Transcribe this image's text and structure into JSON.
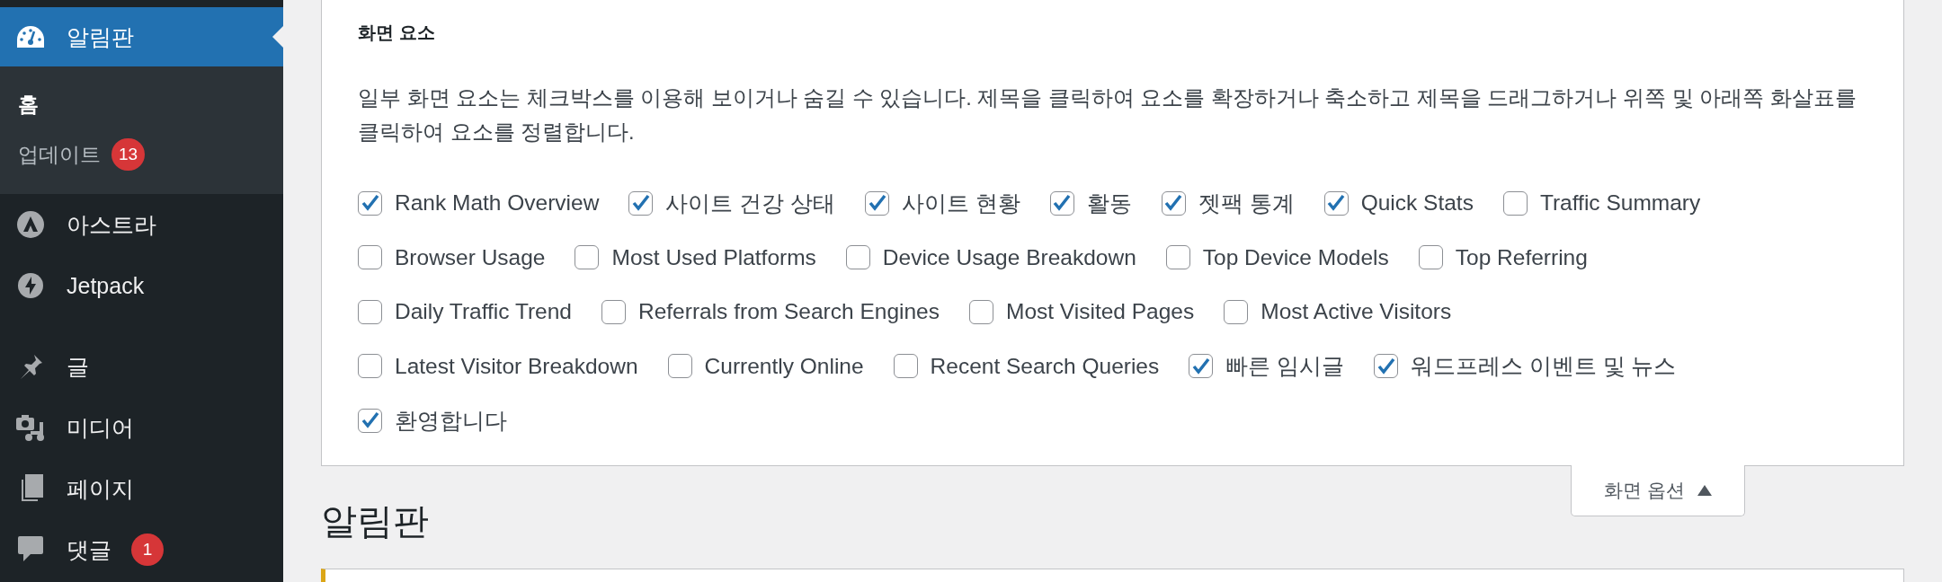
{
  "sidebar": {
    "items": [
      {
        "label": "알림판",
        "selected": true,
        "children": [
          {
            "label": "홈",
            "selected": true
          },
          {
            "label": "업데이트",
            "badge": "13",
            "selected": false
          }
        ]
      },
      {
        "label": "아스트라",
        "selected": false
      },
      {
        "label": "Jetpack",
        "selected": false
      },
      {
        "label": "글",
        "selected": false
      },
      {
        "label": "미디어",
        "selected": false
      },
      {
        "label": "페이지",
        "selected": false
      },
      {
        "label": "댓글",
        "badge": "1",
        "selected": false
      }
    ]
  },
  "screen_options": {
    "title": "화면 요소",
    "description": "일부 화면 요소는 체크박스를 이용해 보이거나 숨길 수 있습니다. 제목을 클릭하여 요소를 확장하거나 축소하고 제목을 드래그하거나 위쪽 및 아래쪽 화살표를 클릭하여 요소를 정렬합니다.",
    "options": [
      {
        "label": "Rank Math Overview",
        "checked": true
      },
      {
        "label": "사이트 건강 상태",
        "checked": true
      },
      {
        "label": "사이트 현황",
        "checked": true
      },
      {
        "label": "활동",
        "checked": true
      },
      {
        "label": "젯팩 통계",
        "checked": true
      },
      {
        "label": "Quick Stats",
        "checked": true
      },
      {
        "label": "Traffic Summary",
        "checked": false
      },
      {
        "label": "Browser Usage",
        "checked": false
      },
      {
        "label": "Most Used Platforms",
        "checked": false
      },
      {
        "label": "Device Usage Breakdown",
        "checked": false
      },
      {
        "label": "Top Device Models",
        "checked": false
      },
      {
        "label": "Top Referring",
        "checked": false
      },
      {
        "label": "Daily Traffic Trend",
        "checked": false
      },
      {
        "label": "Referrals from Search Engines",
        "checked": false
      },
      {
        "label": "Most Visited Pages",
        "checked": false
      },
      {
        "label": "Most Active Visitors",
        "checked": false
      },
      {
        "label": "Latest Visitor Breakdown",
        "checked": false
      },
      {
        "label": "Currently Online",
        "checked": false
      },
      {
        "label": "Recent Search Queries",
        "checked": false
      },
      {
        "label": "빠른 임시글",
        "checked": true
      },
      {
        "label": "워드프레스 이벤트 및 뉴스",
        "checked": true
      },
      {
        "label": "환영합니다",
        "checked": true
      }
    ],
    "toggle": {
      "label": "화면 옵션",
      "expanded": true
    }
  },
  "page_title": "알림판"
}
